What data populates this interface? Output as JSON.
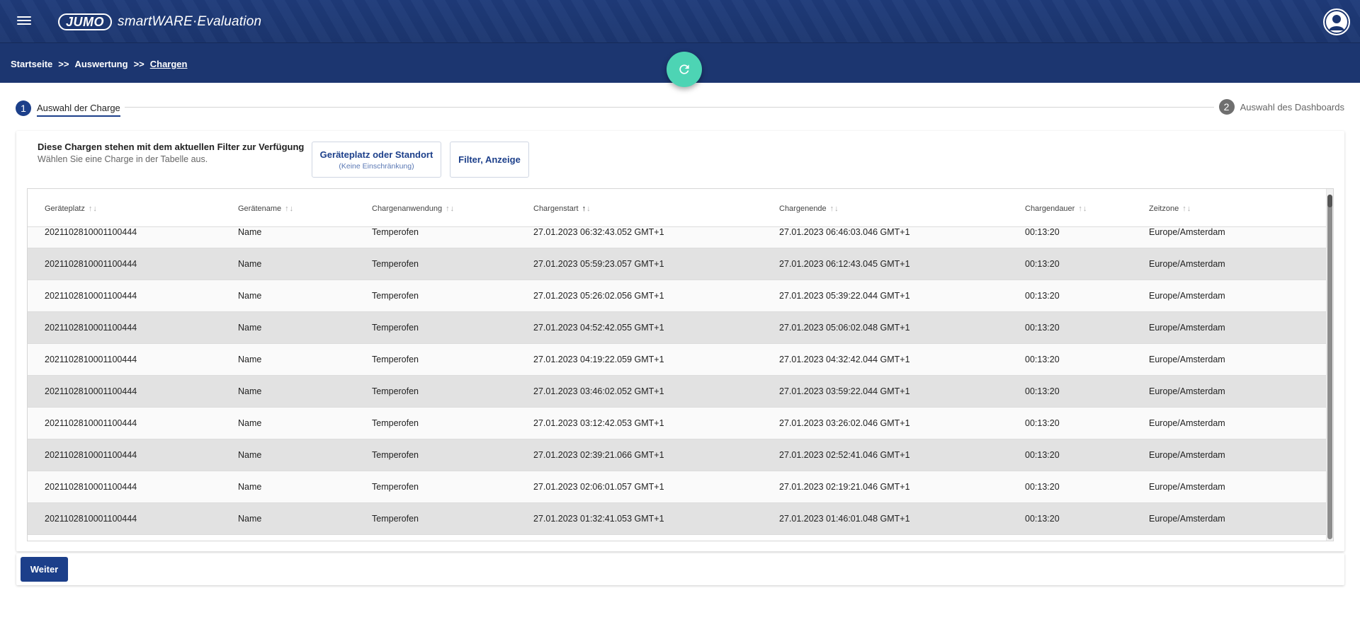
{
  "header": {
    "logo_badge": "JUMO",
    "app_name": "smartWARE·Evaluation",
    "icons": {
      "menu": "hamburger-menu-icon",
      "user": "user-avatar-icon",
      "refresh": "refresh-icon"
    }
  },
  "breadcrumb": {
    "items": [
      "Startseite",
      "Auswertung",
      "Chargen"
    ],
    "separator": ">>"
  },
  "stepper": {
    "steps": [
      {
        "number": "1",
        "label": "Auswahl der Charge",
        "active": true
      },
      {
        "number": "2",
        "label": "Auswahl des Dashboards",
        "active": false
      }
    ]
  },
  "panel": {
    "title": "Diese Chargen stehen mit dem aktuellen Filter zur Verfügung",
    "subtitle": "Wählen Sie eine Charge in der Tabelle aus.",
    "location_button": {
      "label": "Geräteplatz oder Standort",
      "sublabel": "(Keine Einschränkung)"
    },
    "filter_button": {
      "label": "Filter, Anzeige"
    }
  },
  "table": {
    "columns": [
      "Geräteplatz",
      "Gerätename",
      "Chargenanwendung",
      "Chargenstart",
      "Chargenende",
      "Chargendauer",
      "Zeitzone"
    ],
    "sorted_column": "Chargenstart",
    "sort_arrows": {
      "up": "↑",
      "down": "↓"
    },
    "rows": [
      [
        "2021102810001100444",
        "Name",
        "Temperofen",
        "27.01.2023 06:32:43.052 GMT+1",
        "27.01.2023 06:46:03.046 GMT+1",
        "00:13:20",
        "Europe/Amsterdam"
      ],
      [
        "2021102810001100444",
        "Name",
        "Temperofen",
        "27.01.2023 05:59:23.057 GMT+1",
        "27.01.2023 06:12:43.045 GMT+1",
        "00:13:20",
        "Europe/Amsterdam"
      ],
      [
        "2021102810001100444",
        "Name",
        "Temperofen",
        "27.01.2023 05:26:02.056 GMT+1",
        "27.01.2023 05:39:22.044 GMT+1",
        "00:13:20",
        "Europe/Amsterdam"
      ],
      [
        "2021102810001100444",
        "Name",
        "Temperofen",
        "27.01.2023 04:52:42.055 GMT+1",
        "27.01.2023 05:06:02.048 GMT+1",
        "00:13:20",
        "Europe/Amsterdam"
      ],
      [
        "2021102810001100444",
        "Name",
        "Temperofen",
        "27.01.2023 04:19:22.059 GMT+1",
        "27.01.2023 04:32:42.044 GMT+1",
        "00:13:20",
        "Europe/Amsterdam"
      ],
      [
        "2021102810001100444",
        "Name",
        "Temperofen",
        "27.01.2023 03:46:02.052 GMT+1",
        "27.01.2023 03:59:22.044 GMT+1",
        "00:13:20",
        "Europe/Amsterdam"
      ],
      [
        "2021102810001100444",
        "Name",
        "Temperofen",
        "27.01.2023 03:12:42.053 GMT+1",
        "27.01.2023 03:26:02.046 GMT+1",
        "00:13:20",
        "Europe/Amsterdam"
      ],
      [
        "2021102810001100444",
        "Name",
        "Temperofen",
        "27.01.2023 02:39:21.066 GMT+1",
        "27.01.2023 02:52:41.046 GMT+1",
        "00:13:20",
        "Europe/Amsterdam"
      ],
      [
        "2021102810001100444",
        "Name",
        "Temperofen",
        "27.01.2023 02:06:01.057 GMT+1",
        "27.01.2023 02:19:21.046 GMT+1",
        "00:13:20",
        "Europe/Amsterdam"
      ],
      [
        "2021102810001100444",
        "Name",
        "Temperofen",
        "27.01.2023 01:32:41.053 GMT+1",
        "27.01.2023 01:46:01.048 GMT+1",
        "00:13:20",
        "Europe/Amsterdam"
      ]
    ]
  },
  "actions": {
    "next_label": "Weiter"
  },
  "colors": {
    "header_bg": "#1c3670",
    "accent": "#1c3f8a",
    "fab": "#4dd4b4"
  }
}
